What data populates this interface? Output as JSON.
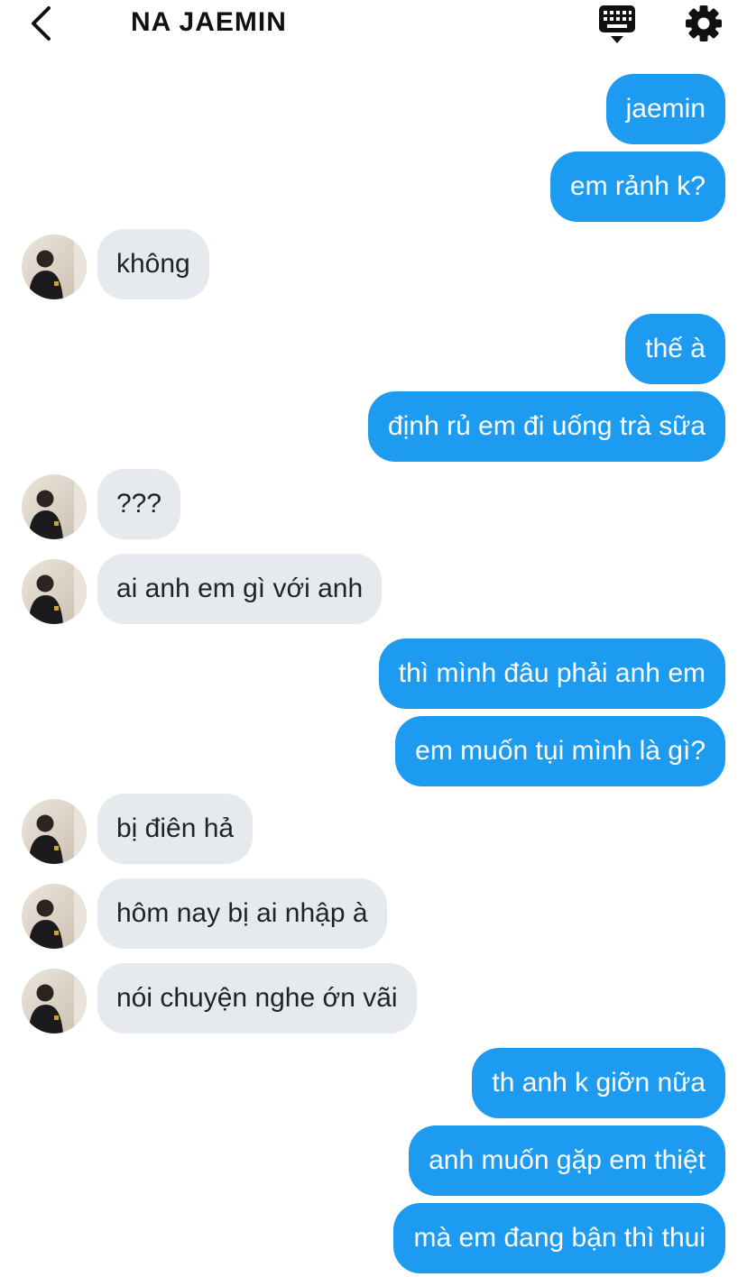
{
  "header": {
    "title": "NA JAEMIN",
    "back_icon": "chevron-left-icon",
    "keyboard_icon": "keyboard-icon",
    "settings_icon": "gear-icon"
  },
  "colors": {
    "sent_bubble": "#1d9bf0",
    "received_bubble": "#e6e9ee",
    "sent_text": "#ffffff",
    "received_text": "#1e2328"
  },
  "messages": [
    {
      "from": "me",
      "text": "jaemin"
    },
    {
      "from": "me",
      "text": "em rảnh k?"
    },
    {
      "from": "them",
      "text": "không"
    },
    {
      "from": "me",
      "text": "thế à"
    },
    {
      "from": "me",
      "text": "định rủ em đi uống trà sữa"
    },
    {
      "from": "them",
      "text": "???"
    },
    {
      "from": "them",
      "text": "ai anh em gì với anh"
    },
    {
      "from": "me",
      "text": "thì mình đâu phải anh em"
    },
    {
      "from": "me",
      "text": "em muốn tụi mình là gì?"
    },
    {
      "from": "them",
      "text": "bị điên hả"
    },
    {
      "from": "them",
      "text": "hôm nay bị ai nhập à"
    },
    {
      "from": "them",
      "text": "nói chuyện nghe ớn vãi"
    },
    {
      "from": "me",
      "text": "th anh k giỡn nữa"
    },
    {
      "from": "me",
      "text": "anh muốn gặp em thiệt"
    },
    {
      "from": "me",
      "text": "mà em đang bận thì thui"
    }
  ]
}
